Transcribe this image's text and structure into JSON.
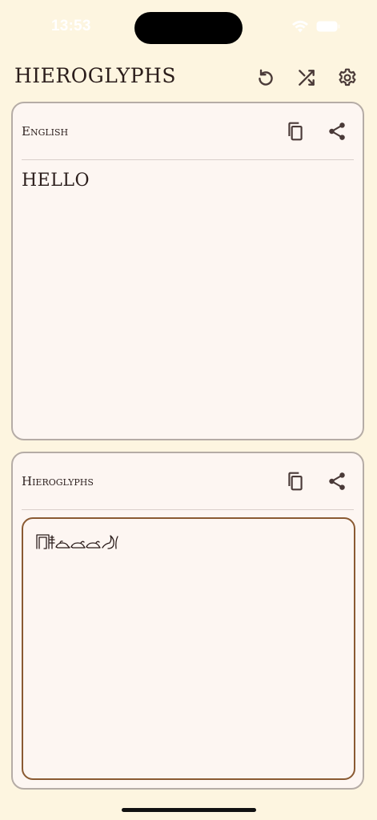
{
  "status_bar": {
    "time": "13:53",
    "icons": [
      "wifi-icon",
      "battery-icon"
    ]
  },
  "header": {
    "title": "HIEROGLYPHS",
    "buttons": [
      {
        "name": "reset-button",
        "icon": "undo-icon"
      },
      {
        "name": "shuffle-button",
        "icon": "shuffle-icon"
      },
      {
        "name": "settings-button",
        "icon": "gear-icon"
      }
    ]
  },
  "input_card": {
    "label": "English",
    "text": "HELLO",
    "actions": [
      {
        "name": "copy-button",
        "icon": "copy-icon"
      },
      {
        "name": "share-button",
        "icon": "share-icon"
      }
    ]
  },
  "output_card": {
    "label": "Hieroglyphs",
    "glyphs": "𓉔𓄿𓃭𓃭𓂝",
    "actions": [
      {
        "name": "copy-button",
        "icon": "copy-icon"
      },
      {
        "name": "share-button",
        "icon": "share-icon"
      }
    ]
  },
  "colors": {
    "background": "#fdf5e0",
    "card": "#fdf6f2",
    "card_border": "#b5aca6",
    "output_border": "#8a5a32",
    "text": "#2b1d1b",
    "icon": "#4a3a38"
  }
}
